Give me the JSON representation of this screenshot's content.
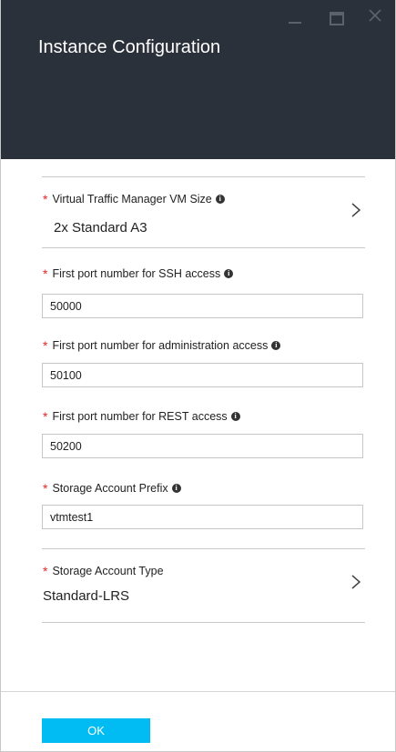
{
  "header": {
    "title": "Instance Configuration",
    "controls": [
      "minimize-icon",
      "maximize-icon",
      "close-icon"
    ]
  },
  "fields": {
    "vm_size": {
      "label": "Virtual Traffic Manager VM Size",
      "value": "2x Standard A3"
    },
    "ssh_port": {
      "label": "First port number for SSH access",
      "value": "50000"
    },
    "admin_port": {
      "label": "First port number for administration access",
      "value": "50100"
    },
    "rest_port": {
      "label": "First port number for REST access",
      "value": "50200"
    },
    "storage_prefix": {
      "label": "Storage Account Prefix",
      "value": "vtmtest1"
    },
    "storage_type": {
      "label": "Storage Account Type",
      "value": "Standard-LRS"
    }
  },
  "required_marker": "*",
  "info_glyph": "i",
  "footer": {
    "ok_label": "OK"
  },
  "colors": {
    "header_bg": "#2b313a",
    "accent": "#00bcf2",
    "required": "#e22222"
  }
}
